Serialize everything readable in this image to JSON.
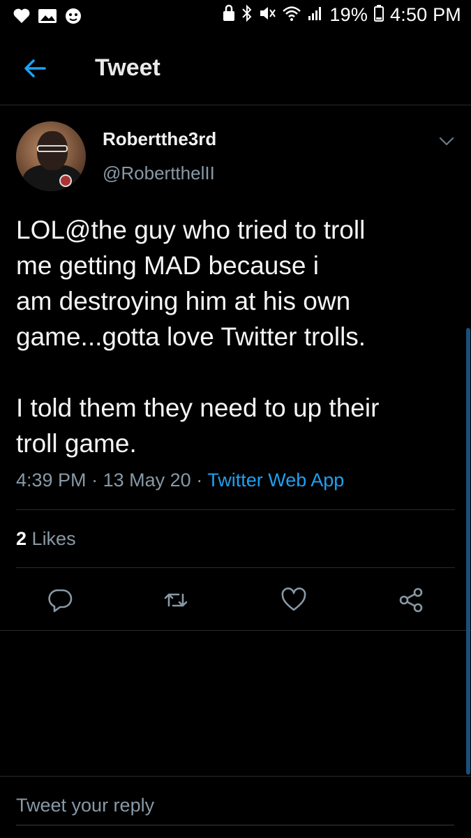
{
  "status_bar": {
    "battery_percent": "19%",
    "time": "4:50 PM",
    "left_icons": [
      "heart-icon",
      "image-icon",
      "face-icon"
    ],
    "right_icons": [
      "lock-icon",
      "bluetooth-icon",
      "mute-icon",
      "wifi-icon",
      "signal-icon",
      "battery-icon"
    ]
  },
  "header": {
    "title": "Tweet",
    "back_icon": "back-arrow-icon"
  },
  "tweet": {
    "display_name": "Robertthe3rd",
    "handle": "@RobertthelII",
    "text": "LOL@the guy who tried to troll\nme getting MAD because i\nam destroying him at his own\ngame...gotta love Twitter trolls.\n\nI told them they need to up their\ntroll game.",
    "time": "4:39 PM",
    "date": "13 May 20",
    "separator": "·",
    "source": "Twitter Web App",
    "likes_count": "2",
    "likes_label": "Likes"
  },
  "actions": [
    "reply-icon",
    "retweet-icon",
    "like-icon",
    "share-icon"
  ],
  "reply": {
    "placeholder": "Tweet your reply"
  },
  "colors": {
    "background": "#000000",
    "accent": "#1da1f2",
    "secondary_text": "#8899a6",
    "divider": "#2a2a2a"
  }
}
